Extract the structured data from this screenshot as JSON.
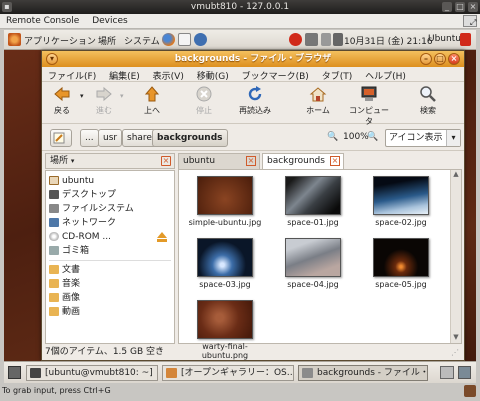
{
  "vm": {
    "title": "vmubt810 - 127.0.0.1",
    "menu": [
      "Remote Console",
      "Devices"
    ],
    "hint": "To grab input, press Ctrl+G"
  },
  "panel": {
    "menus": [
      "アプリケーション",
      "場所",
      "システム"
    ],
    "datetime": "10月31日 (金) 21:16",
    "user": "Ubuntu"
  },
  "window": {
    "title": "backgrounds - ファイル・ブラウザ",
    "menu": [
      "ファイル(F)",
      "編集(E)",
      "表示(V)",
      "移動(G)",
      "ブックマーク(B)",
      "タブ(T)",
      "ヘルプ(H)"
    ],
    "toolbar": {
      "back": "戻る",
      "forward": "進む",
      "up": "上へ",
      "stop": "停止",
      "reload": "再読込み",
      "home": "ホーム",
      "computer": "コンピュータ",
      "search": "検索"
    },
    "path": [
      "...",
      "usr",
      "share",
      "backgrounds"
    ],
    "zoom": "100%",
    "view_mode": "アイコン表示",
    "sidebar": {
      "header": "場所",
      "items": [
        {
          "label": "ubuntu",
          "icon": "home-icon"
        },
        {
          "label": "デスクトップ",
          "icon": "desktop-icon"
        },
        {
          "label": "ファイルシステム",
          "icon": "drive-icon"
        },
        {
          "label": "ネットワーク",
          "icon": "network-icon"
        },
        {
          "label": "CD-ROM ...",
          "icon": "cdrom-icon"
        },
        {
          "label": "ゴミ箱",
          "icon": "trash-icon"
        },
        {
          "label": "文書",
          "icon": "folder-icon"
        },
        {
          "label": "音楽",
          "icon": "folder-icon"
        },
        {
          "label": "画像",
          "icon": "folder-icon"
        },
        {
          "label": "動画",
          "icon": "folder-icon"
        }
      ]
    },
    "tabs": [
      "ubuntu",
      "backgrounds"
    ],
    "files": [
      {
        "name": "simple-ubuntu.jpg",
        "color": "#6a2f14"
      },
      {
        "name": "space-01.jpg",
        "color": "#3a3f44"
      },
      {
        "name": "space-02.jpg",
        "color": "#1d3a5a"
      },
      {
        "name": "space-03.jpg",
        "color": "#0c1d33"
      },
      {
        "name": "space-04.jpg",
        "color": "#8b8f96"
      },
      {
        "name": "space-05.jpg",
        "color": "#120c08"
      },
      {
        "name": "warty-final-ubuntu.png",
        "color": "#7b3a22"
      }
    ],
    "status": "7個のアイテム、1.5 GB 空き"
  },
  "taskbar": [
    "[ubuntu@vmubt810: ~]",
    "[オープンギャラリー：OS…",
    "backgrounds - ファイル・ブ…"
  ],
  "colors": {
    "title_orange": "#e79b2a",
    "desktop_brown": "#5a2712"
  }
}
